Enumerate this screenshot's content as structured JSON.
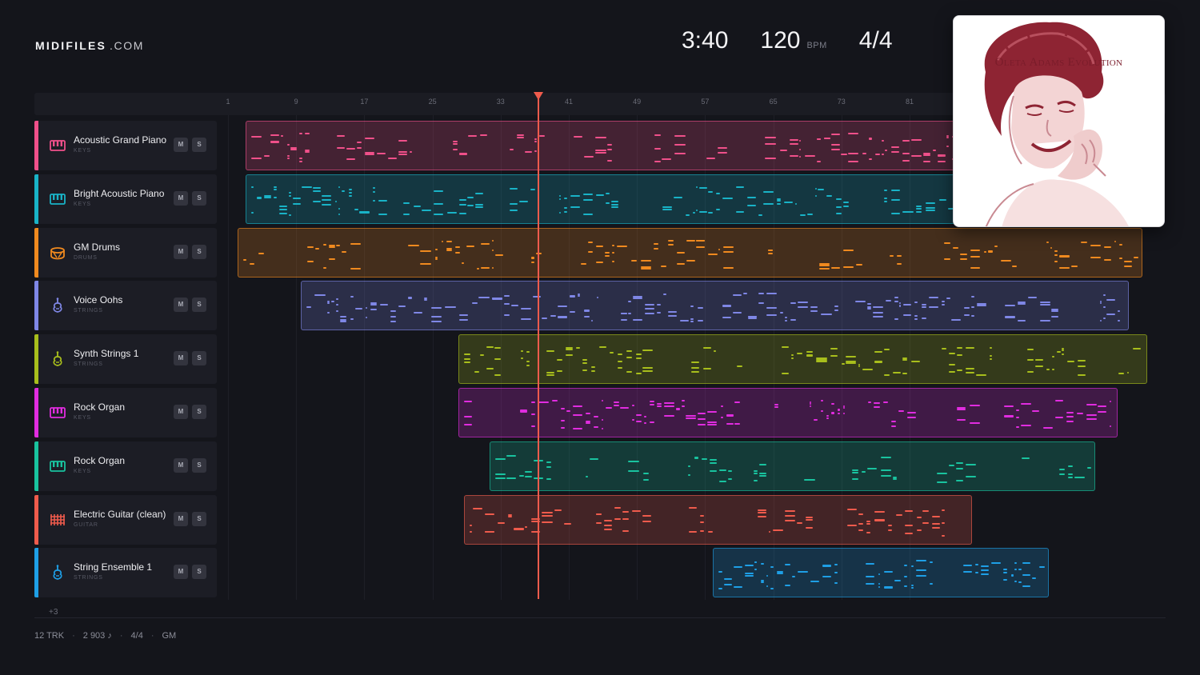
{
  "brand": {
    "name_bold": "MIDIFILES",
    "name_light": ".COM"
  },
  "transport": {
    "time": "3:40",
    "bpm": "120",
    "bpm_unit": "BPM",
    "time_signature": "4/4"
  },
  "album": {
    "title": "Oleta Adams Evolution",
    "ink_color": "#7a1c2a"
  },
  "ruler": {
    "ticks": [
      "1",
      "9",
      "17",
      "25",
      "33",
      "41",
      "49",
      "57",
      "65",
      "73",
      "81"
    ]
  },
  "playhead": {
    "color": "#ef5b4c",
    "bar": 37.4
  },
  "tracks": [
    {
      "name": "Acoustic Grand Piano",
      "category": "KEYS",
      "icon": "piano-icon",
      "color": "#f0508a",
      "clip_start_bar": 3.1,
      "clip_end_bar": 93.5,
      "mute_label": "M",
      "solo_label": "S"
    },
    {
      "name": "Bright Acoustic Piano",
      "category": "KEYS",
      "icon": "piano-icon",
      "color": "#19b3c7",
      "clip_start_bar": 3.1,
      "clip_end_bar": 93.5,
      "mute_label": "M",
      "solo_label": "S"
    },
    {
      "name": "GM Drums",
      "category": "DRUMS",
      "icon": "drum-icon",
      "color": "#f08a1f",
      "clip_start_bar": 2.1,
      "clip_end_bar": 108.3,
      "mute_label": "M",
      "solo_label": "S"
    },
    {
      "name": "Voice Oohs",
      "category": "STRINGS",
      "icon": "violin-icon",
      "color": "#7f87e6",
      "clip_start_bar": 9.5,
      "clip_end_bar": 106.7,
      "mute_label": "M",
      "solo_label": "S"
    },
    {
      "name": "Synth Strings 1",
      "category": "STRINGS",
      "icon": "violin-icon",
      "color": "#a8be1c",
      "clip_start_bar": 28.0,
      "clip_end_bar": 108.9,
      "mute_label": "M",
      "solo_label": "S"
    },
    {
      "name": "Rock Organ",
      "category": "KEYS",
      "icon": "piano-icon",
      "color": "#e12ce0",
      "clip_start_bar": 28.0,
      "clip_end_bar": 105.4,
      "mute_label": "M",
      "solo_label": "S"
    },
    {
      "name": "Rock Organ",
      "category": "KEYS",
      "icon": "piano-icon",
      "color": "#19c39f",
      "clip_start_bar": 31.7,
      "clip_end_bar": 102.8,
      "mute_label": "M",
      "solo_label": "S"
    },
    {
      "name": "Electric Guitar (clean)",
      "category": "GUITAR",
      "icon": "guitar-grid-icon",
      "color": "#ef5b4c",
      "clip_start_bar": 28.7,
      "clip_end_bar": 88.3,
      "mute_label": "M",
      "solo_label": "S"
    },
    {
      "name": "String Ensemble 1",
      "category": "STRINGS",
      "icon": "violin-icon",
      "color": "#1e9fe6",
      "clip_start_bar": 57.9,
      "clip_end_bar": 97.3,
      "mute_label": "M",
      "solo_label": "S"
    }
  ],
  "more_tracks": "+3",
  "footer": {
    "tracks": "12 TRK",
    "notes": "2 903 ♪",
    "signature": "4/4",
    "standard": "GM"
  }
}
